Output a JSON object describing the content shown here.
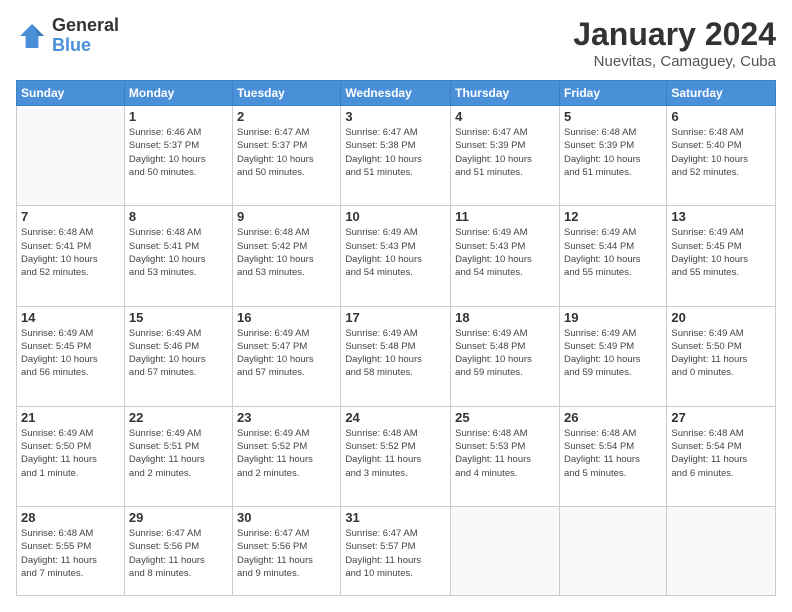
{
  "logo": {
    "general": "General",
    "blue": "Blue"
  },
  "header": {
    "month": "January 2024",
    "location": "Nuevitas, Camaguey, Cuba"
  },
  "days_of_week": [
    "Sunday",
    "Monday",
    "Tuesday",
    "Wednesday",
    "Thursday",
    "Friday",
    "Saturday"
  ],
  "weeks": [
    [
      {
        "num": "",
        "sunrise": "",
        "sunset": "",
        "daylight": ""
      },
      {
        "num": "1",
        "sunrise": "Sunrise: 6:46 AM",
        "sunset": "Sunset: 5:37 PM",
        "daylight": "Daylight: 10 hours and 50 minutes."
      },
      {
        "num": "2",
        "sunrise": "Sunrise: 6:47 AM",
        "sunset": "Sunset: 5:37 PM",
        "daylight": "Daylight: 10 hours and 50 minutes."
      },
      {
        "num": "3",
        "sunrise": "Sunrise: 6:47 AM",
        "sunset": "Sunset: 5:38 PM",
        "daylight": "Daylight: 10 hours and 51 minutes."
      },
      {
        "num": "4",
        "sunrise": "Sunrise: 6:47 AM",
        "sunset": "Sunset: 5:39 PM",
        "daylight": "Daylight: 10 hours and 51 minutes."
      },
      {
        "num": "5",
        "sunrise": "Sunrise: 6:48 AM",
        "sunset": "Sunset: 5:39 PM",
        "daylight": "Daylight: 10 hours and 51 minutes."
      },
      {
        "num": "6",
        "sunrise": "Sunrise: 6:48 AM",
        "sunset": "Sunset: 5:40 PM",
        "daylight": "Daylight: 10 hours and 52 minutes."
      }
    ],
    [
      {
        "num": "7",
        "sunrise": "Sunrise: 6:48 AM",
        "sunset": "Sunset: 5:41 PM",
        "daylight": "Daylight: 10 hours and 52 minutes."
      },
      {
        "num": "8",
        "sunrise": "Sunrise: 6:48 AM",
        "sunset": "Sunset: 5:41 PM",
        "daylight": "Daylight: 10 hours and 53 minutes."
      },
      {
        "num": "9",
        "sunrise": "Sunrise: 6:48 AM",
        "sunset": "Sunset: 5:42 PM",
        "daylight": "Daylight: 10 hours and 53 minutes."
      },
      {
        "num": "10",
        "sunrise": "Sunrise: 6:49 AM",
        "sunset": "Sunset: 5:43 PM",
        "daylight": "Daylight: 10 hours and 54 minutes."
      },
      {
        "num": "11",
        "sunrise": "Sunrise: 6:49 AM",
        "sunset": "Sunset: 5:43 PM",
        "daylight": "Daylight: 10 hours and 54 minutes."
      },
      {
        "num": "12",
        "sunrise": "Sunrise: 6:49 AM",
        "sunset": "Sunset: 5:44 PM",
        "daylight": "Daylight: 10 hours and 55 minutes."
      },
      {
        "num": "13",
        "sunrise": "Sunrise: 6:49 AM",
        "sunset": "Sunset: 5:45 PM",
        "daylight": "Daylight: 10 hours and 55 minutes."
      }
    ],
    [
      {
        "num": "14",
        "sunrise": "Sunrise: 6:49 AM",
        "sunset": "Sunset: 5:45 PM",
        "daylight": "Daylight: 10 hours and 56 minutes."
      },
      {
        "num": "15",
        "sunrise": "Sunrise: 6:49 AM",
        "sunset": "Sunset: 5:46 PM",
        "daylight": "Daylight: 10 hours and 57 minutes."
      },
      {
        "num": "16",
        "sunrise": "Sunrise: 6:49 AM",
        "sunset": "Sunset: 5:47 PM",
        "daylight": "Daylight: 10 hours and 57 minutes."
      },
      {
        "num": "17",
        "sunrise": "Sunrise: 6:49 AM",
        "sunset": "Sunset: 5:48 PM",
        "daylight": "Daylight: 10 hours and 58 minutes."
      },
      {
        "num": "18",
        "sunrise": "Sunrise: 6:49 AM",
        "sunset": "Sunset: 5:48 PM",
        "daylight": "Daylight: 10 hours and 59 minutes."
      },
      {
        "num": "19",
        "sunrise": "Sunrise: 6:49 AM",
        "sunset": "Sunset: 5:49 PM",
        "daylight": "Daylight: 10 hours and 59 minutes."
      },
      {
        "num": "20",
        "sunrise": "Sunrise: 6:49 AM",
        "sunset": "Sunset: 5:50 PM",
        "daylight": "Daylight: 11 hours and 0 minutes."
      }
    ],
    [
      {
        "num": "21",
        "sunrise": "Sunrise: 6:49 AM",
        "sunset": "Sunset: 5:50 PM",
        "daylight": "Daylight: 11 hours and 1 minute."
      },
      {
        "num": "22",
        "sunrise": "Sunrise: 6:49 AM",
        "sunset": "Sunset: 5:51 PM",
        "daylight": "Daylight: 11 hours and 2 minutes."
      },
      {
        "num": "23",
        "sunrise": "Sunrise: 6:49 AM",
        "sunset": "Sunset: 5:52 PM",
        "daylight": "Daylight: 11 hours and 2 minutes."
      },
      {
        "num": "24",
        "sunrise": "Sunrise: 6:48 AM",
        "sunset": "Sunset: 5:52 PM",
        "daylight": "Daylight: 11 hours and 3 minutes."
      },
      {
        "num": "25",
        "sunrise": "Sunrise: 6:48 AM",
        "sunset": "Sunset: 5:53 PM",
        "daylight": "Daylight: 11 hours and 4 minutes."
      },
      {
        "num": "26",
        "sunrise": "Sunrise: 6:48 AM",
        "sunset": "Sunset: 5:54 PM",
        "daylight": "Daylight: 11 hours and 5 minutes."
      },
      {
        "num": "27",
        "sunrise": "Sunrise: 6:48 AM",
        "sunset": "Sunset: 5:54 PM",
        "daylight": "Daylight: 11 hours and 6 minutes."
      }
    ],
    [
      {
        "num": "28",
        "sunrise": "Sunrise: 6:48 AM",
        "sunset": "Sunset: 5:55 PM",
        "daylight": "Daylight: 11 hours and 7 minutes."
      },
      {
        "num": "29",
        "sunrise": "Sunrise: 6:47 AM",
        "sunset": "Sunset: 5:56 PM",
        "daylight": "Daylight: 11 hours and 8 minutes."
      },
      {
        "num": "30",
        "sunrise": "Sunrise: 6:47 AM",
        "sunset": "Sunset: 5:56 PM",
        "daylight": "Daylight: 11 hours and 9 minutes."
      },
      {
        "num": "31",
        "sunrise": "Sunrise: 6:47 AM",
        "sunset": "Sunset: 5:57 PM",
        "daylight": "Daylight: 11 hours and 10 minutes."
      },
      {
        "num": "",
        "sunrise": "",
        "sunset": "",
        "daylight": ""
      },
      {
        "num": "",
        "sunrise": "",
        "sunset": "",
        "daylight": ""
      },
      {
        "num": "",
        "sunrise": "",
        "sunset": "",
        "daylight": ""
      }
    ]
  ]
}
